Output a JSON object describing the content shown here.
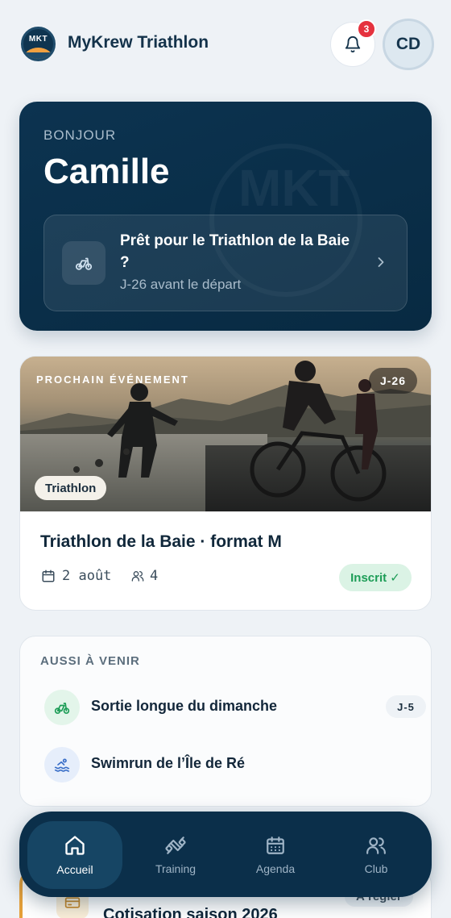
{
  "header": {
    "logo_text": "MKT",
    "app_title": "MyKrew Triathlon",
    "notification_count": "3",
    "avatar_initials": "CD"
  },
  "hero": {
    "greeting": "BONJOUR",
    "user_name": "Camille",
    "watermark": "MKT",
    "next_event_title": "Prêt pour le Triathlon de la Baie ?",
    "next_event_countdown": "J-26 avant le départ"
  },
  "event": {
    "section_label": "PROCHAIN ÉVÉNEMENT",
    "days_left": "J-26",
    "tag": "Triathlon",
    "title": "Triathlon de la Baie · format M",
    "date": "2 août",
    "participants": "4",
    "status": "Inscrit ✓"
  },
  "upcoming": {
    "header": "AUSSI À VENIR",
    "items": [
      {
        "label": "Sortie longue du dimanche",
        "icon": "bike-icon",
        "days_left": "J-5"
      },
      {
        "label": "Swimrun de l’Île de Ré",
        "icon": "swim-icon",
        "days_left": ""
      }
    ]
  },
  "peek_card": {
    "title": "Cotisation saison 2026",
    "pill": "À régler",
    "icon": "card-icon"
  },
  "nav": {
    "items": [
      {
        "label": "Accueil",
        "icon": "home-icon",
        "active": true
      },
      {
        "label": "Training",
        "icon": "training-icon",
        "active": false
      },
      {
        "label": "Agenda",
        "icon": "calendar-icon",
        "active": false
      },
      {
        "label": "Club",
        "icon": "users-icon",
        "active": false
      }
    ]
  },
  "colors": {
    "primary_dark": "#0b2f4a",
    "accent_green": "#1d9d57",
    "badge_red": "#e5323e",
    "background": "#eef2f6"
  }
}
